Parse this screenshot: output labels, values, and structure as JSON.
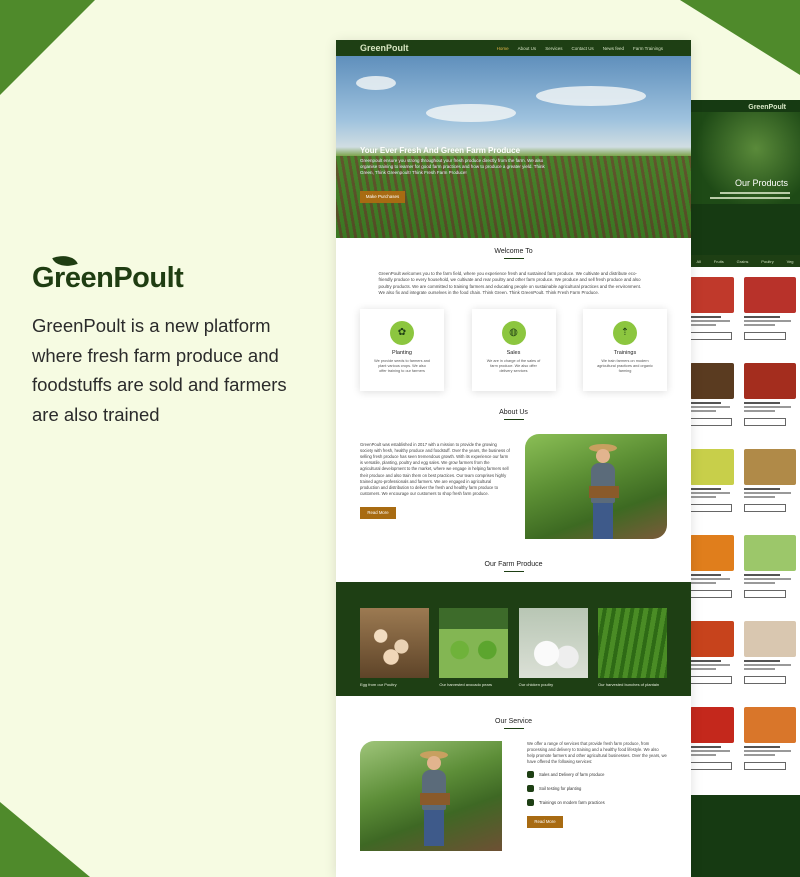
{
  "brand": {
    "name": "GreenPoult",
    "tagline": "GreenPoult is a new platform where fresh farm produce and foodstuffs are sold and farmers are also trained"
  },
  "nav": {
    "logo": "GreenPoult",
    "links": [
      "Home",
      "About Us",
      "Services",
      "Contact Us",
      "News feed",
      "Farm Trainings"
    ]
  },
  "hero": {
    "title": "Your Ever Fresh And Green Farm Produce",
    "subtitle": "Greenpoult ensure you strong throughout your fresh produce directly from the farm. We also organise training to learner for good farm practices and how to produce a greater yield. Think Green, Think Greenpoult! Think Fresh Farm Produce!",
    "button": "Make Purchases"
  },
  "welcome": {
    "title": "Welcome To",
    "text": "GreenPoult welcomes you to the farm field, where you experience fresh and sustained farm produce. We cultivate and distribute eco-friendly produce to every household, we cultivate and rear poultry and other farm produce. We produce and sell fresh produce and also poultry products. We are committed to training farmers and educating people on sustainable agricultural practices and the environment. We also fix and integrate ourselves in the food chain. Think Green. Think GreenPoult. Think Fresh Farm Produce."
  },
  "cards": [
    {
      "icon": "leaf-icon",
      "title": "Planting",
      "text": "We provide seeds to farmers and plant various crops. We also offer training to our farmers"
    },
    {
      "icon": "sales-icon",
      "title": "Sales",
      "text": "We are in charge of the sales of farm produce. We also offer delivery services"
    },
    {
      "icon": "training-icon",
      "title": "Trainings",
      "text": "We train farmers on modern agricultural practices and organic farming"
    }
  ],
  "about": {
    "title": "About Us",
    "text": "GreenPoult was established in 2017 with a mission to provide the growing society with fresh, healthy produce and foodstuff. Over the years, the business of selling fresh produce has seen tremendous growth. With its experience our farm is versatile, planting, poultry and egg sales. We grow farmers from the agricultural development to the market, where we engage in helping farmers sell their produce and also train them on best practices. Our team comprises highly trained agro-professionals and farmers. We are engaged in agricultural production and distribution to deliver the fresh and healthy farm produce to customers. We encourage our customers to shop fresh farm produce.",
    "button": "Read More"
  },
  "produce": {
    "title": "Our Farm Produce",
    "items": [
      {
        "caption": "Egg from our Poultry"
      },
      {
        "caption": "Our harvested avocado pears"
      },
      {
        "caption": "Our chicken poultry"
      },
      {
        "caption": "Our harvested bunches of plantain"
      }
    ]
  },
  "service": {
    "title": "Our Service",
    "text": "We offer a range of services that provide fresh farm produce, from processing and delivery to training and a healthy food lifestyle. We also help promote farmers and other agricultural businesses. Over the years, we have offered the following services:",
    "items": [
      "Sales and Delivery of farm produce",
      "Soil testing for planting",
      "Trainings on modern farm practices"
    ],
    "button": "Read More"
  },
  "page2": {
    "logo": "GreenPoult",
    "title": "Our Products",
    "nav": [
      "All",
      "Fruits",
      "Grains",
      "Poultry",
      "Veg"
    ],
    "products": [
      {
        "color": "#c0392b"
      },
      {
        "color": "#b8322a"
      },
      {
        "color": "#5a3b20"
      },
      {
        "color": "#a42d1e"
      },
      {
        "color": "#c8cf4a"
      },
      {
        "color": "#b08a48"
      },
      {
        "color": "#e07e1c"
      },
      {
        "color": "#9cc76a"
      },
      {
        "color": "#c7431c"
      },
      {
        "color": "#d9c7b0"
      },
      {
        "color": "#c4281c"
      },
      {
        "color": "#d9762a"
      }
    ]
  }
}
